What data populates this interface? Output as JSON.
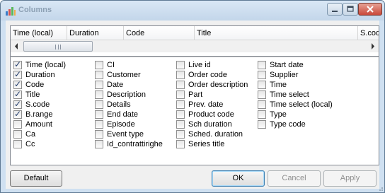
{
  "window": {
    "title": "Columns",
    "accent_color": "#cfe0f1"
  },
  "icons": {
    "app": "columns-chart-icon",
    "minimize": "minimize-icon",
    "maximize": "maximize-icon",
    "close": "close-icon",
    "scroll_left": "scroll-left-arrow-icon",
    "scroll_right": "scroll-right-arrow-icon"
  },
  "header_columns": [
    "Time (local)",
    "Duration",
    "Code",
    "Title",
    "S.cod"
  ],
  "checklist": [
    [
      {
        "label": "Time (local)",
        "checked": true
      },
      {
        "label": "Duration",
        "checked": true
      },
      {
        "label": "Code",
        "checked": true
      },
      {
        "label": "Title",
        "checked": true
      },
      {
        "label": "S.code",
        "checked": true
      },
      {
        "label": "B.range",
        "checked": true
      },
      {
        "label": "Amount",
        "checked": false
      },
      {
        "label": "Ca",
        "checked": false
      },
      {
        "label": "Cc",
        "checked": false
      }
    ],
    [
      {
        "label": "CI",
        "checked": false
      },
      {
        "label": "Customer",
        "checked": false
      },
      {
        "label": "Date",
        "checked": false
      },
      {
        "label": "Description",
        "checked": false
      },
      {
        "label": "Details",
        "checked": false
      },
      {
        "label": "End date",
        "checked": false
      },
      {
        "label": "Episode",
        "checked": false
      },
      {
        "label": "Event type",
        "checked": false
      },
      {
        "label": "Id_contrattirighe",
        "checked": false
      }
    ],
    [
      {
        "label": "Live id",
        "checked": false
      },
      {
        "label": "Order code",
        "checked": false
      },
      {
        "label": "Order description",
        "checked": false
      },
      {
        "label": "Part",
        "checked": false
      },
      {
        "label": "Prev. date",
        "checked": false
      },
      {
        "label": "Product code",
        "checked": false
      },
      {
        "label": "Sch duration",
        "checked": false
      },
      {
        "label": "Sched. duration",
        "checked": false
      },
      {
        "label": "Series title",
        "checked": false
      }
    ],
    [
      {
        "label": "Start date",
        "checked": false
      },
      {
        "label": "Supplier",
        "checked": false
      },
      {
        "label": "Time",
        "checked": false
      },
      {
        "label": "Time select",
        "checked": false
      },
      {
        "label": "Time select (local)",
        "checked": false
      },
      {
        "label": "Type",
        "checked": false
      },
      {
        "label": "Type code",
        "checked": false
      }
    ]
  ],
  "buttons": {
    "default": "Default",
    "ok": "OK",
    "cancel": "Cancel",
    "apply": "Apply"
  }
}
